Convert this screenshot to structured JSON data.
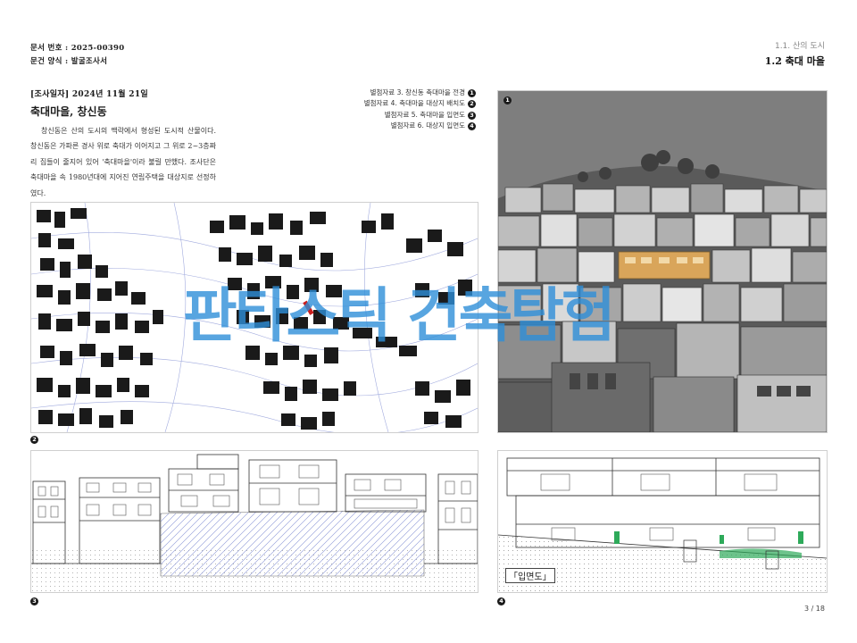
{
  "document": {
    "number": "문서 번호 : 2025-00390",
    "form": "문건 양식 : 발굴조사서"
  },
  "section": {
    "parent": "1.1. 산의 도시",
    "current": "1.2 축대 마을"
  },
  "survey": {
    "date_line": "[조사일자] 2024년 11월 21일",
    "place_title": "축대마을, 창신동",
    "body": "창신동은 산의 도시의 맥락에서 형성된 도시적 산물이다. 창신동은 가파른 경사 위로 축대가 이어지고 그 위로 2~3층짜리 집들이 줄지어 있어 '축대마을'이라 불릴 만했다. 조사단은 축대마을 속 1980년대에 지어진 연립주택을 대상지로 선정하였다."
  },
  "attachments": [
    {
      "label": "별첨자료 3. 창신동 축대마을 전경",
      "num": "1"
    },
    {
      "label": "별첨자료 4. 축대마을 대상지 배치도",
      "num": "2"
    },
    {
      "label": "별첨자료 5. 축대마을 입면도",
      "num": "3"
    },
    {
      "label": "별첨자료 6. 대상지 입면도",
      "num": "4"
    }
  ],
  "figures": {
    "photo_num": "1",
    "map_num": "2",
    "elevation_num": "3",
    "site_elevation_num": "4",
    "stamp": "「입면도」"
  },
  "watermark": "판타스틱 건축탐험",
  "page": "3 / 18",
  "colors": {
    "watermark": "#2f8fd9",
    "highlight": "#d9a55a",
    "hatch": "#8a96d6"
  }
}
